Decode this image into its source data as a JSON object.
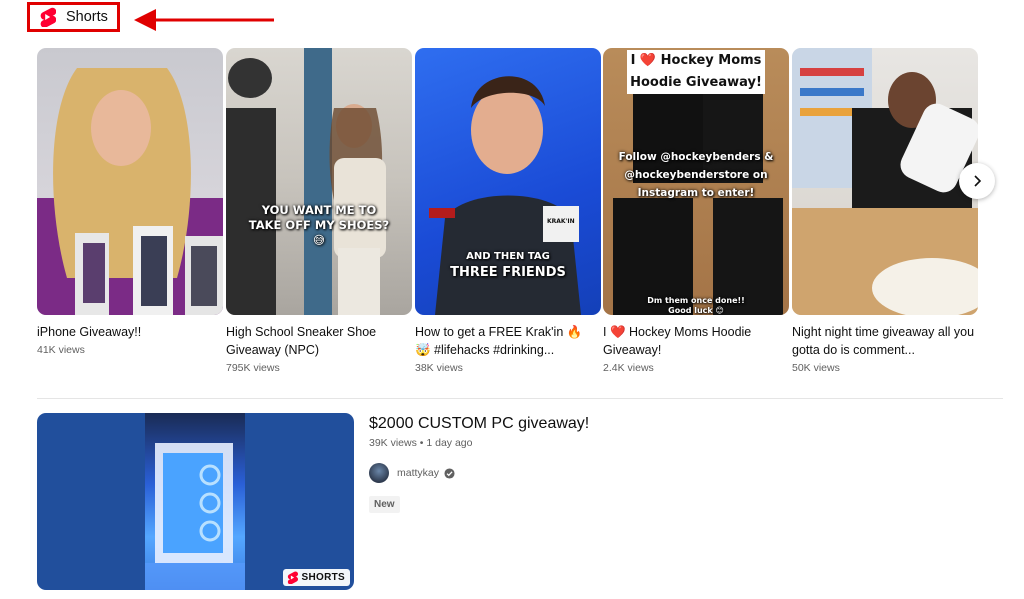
{
  "header": {
    "title": "Shorts",
    "icon": "youtube-shorts-icon"
  },
  "accent_color": "#e00000",
  "shorts": [
    {
      "title": "iPhone Giveaway!!",
      "views": "41K views"
    },
    {
      "title": "High School Sneaker Shoe Giveaway (NPC)",
      "views": "795K views",
      "overlay": "YOU WANT ME TO TAKE OFF MY SHOES? 😅"
    },
    {
      "title": "How to get a FREE Krak'in 🔥 🤯 #lifehacks #drinking...",
      "views": "38K views",
      "overlay_small": "AND THEN TAG",
      "overlay_big": "THREE FRIENDS",
      "box_label": "KRAK'IN"
    },
    {
      "title": "I ❤️ Hockey Moms Hoodie Giveaway!",
      "views": "2.4K views",
      "banner": "I ❤️ Hockey Moms Hoodie Giveaway!",
      "overlay": "Follow @hockeybenders & @hockeybenderstore on Instagram to enter!",
      "overlay_small": "Dm them once done!! Good luck 😊"
    },
    {
      "title": "Night night time giveaway all you gotta do is comment...",
      "views": "50K views"
    }
  ],
  "next_icon": "chevron-right-icon",
  "video": {
    "title": "$2000 CUSTOM PC giveaway!",
    "meta": "39K views • 1 day ago",
    "channel": "mattykay",
    "verified_icon": "verified-check-icon",
    "badge": "New",
    "shorts_badge": "SHORTS"
  }
}
